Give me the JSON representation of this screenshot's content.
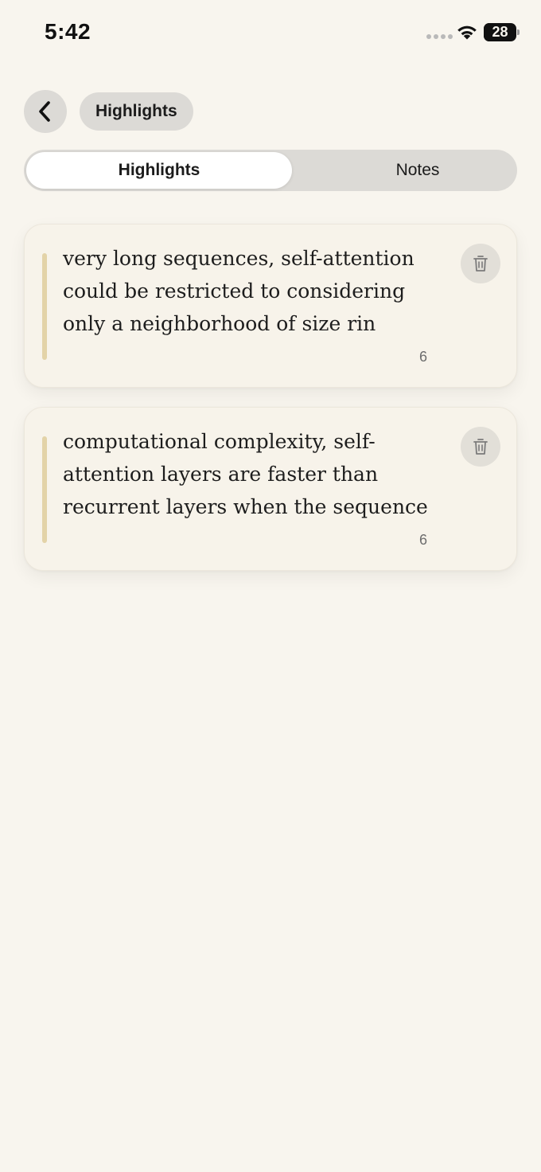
{
  "status_bar": {
    "time": "5:42",
    "battery": "28",
    "icons": [
      "cellular-icon",
      "wifi-icon",
      "battery-icon"
    ]
  },
  "header": {
    "back_icon": "chevron-left-icon",
    "title": "Highlights"
  },
  "tabs": [
    {
      "label": "Highlights",
      "selected": true
    },
    {
      "label": "Notes",
      "selected": false
    }
  ],
  "highlights": [
    {
      "lines": [
        "very long sequences, self-attention",
        "could be restricted to considering",
        "only a neighborhood of size rin"
      ],
      "page": "6",
      "delete_icon": "trash-icon"
    },
    {
      "lines": [
        "computational complexity, self-",
        "attention layers are faster than",
        "recurrent layers when the sequence"
      ],
      "page": "6",
      "delete_icon": "trash-icon"
    }
  ],
  "colors": {
    "background": "#f8f5ee",
    "pill": "#dcdad6",
    "card": "#f7f3ea",
    "highlight_bar": "#e3d3a8"
  }
}
